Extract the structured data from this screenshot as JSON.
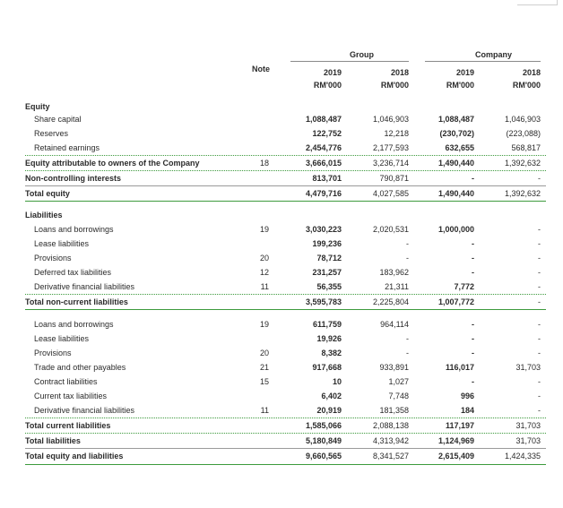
{
  "header": {
    "note": "Note",
    "group_label": "Group",
    "company_label": "Company",
    "years": [
      "2019",
      "2018",
      "2019",
      "2018"
    ],
    "units": [
      "RM'000",
      "RM'000",
      "RM'000",
      "RM'000"
    ]
  },
  "sections": {
    "equity": "Equity",
    "liabilities": "Liabilities"
  },
  "rows": [
    {
      "label": "Share capital",
      "note": "",
      "g19": "1,088,487",
      "g18": "1,046,903",
      "c19": "1,088,487",
      "c18": "1,046,903"
    },
    {
      "label": "Reserves",
      "note": "",
      "g19": "122,752",
      "g18": "12,218",
      "c19": "(230,702)",
      "c18": "(223,088)"
    },
    {
      "label": "Retained earnings",
      "note": "",
      "g19": "2,454,776",
      "g18": "2,177,593",
      "c19": "632,655",
      "c18": "568,817"
    },
    {
      "label": "Equity attributable to owners of the Company",
      "note": "18",
      "g19": "3,666,015",
      "g18": "3,236,714",
      "c19": "1,490,440",
      "c18": "1,392,632"
    },
    {
      "label": "Non-controlling interests",
      "note": "",
      "g19": "813,701",
      "g18": "790,871",
      "c19": "-",
      "c18": "-"
    },
    {
      "label": "Total equity",
      "note": "",
      "g19": "4,479,716",
      "g18": "4,027,585",
      "c19": "1,490,440",
      "c18": "1,392,632"
    },
    {
      "label": "Loans and borrowings",
      "note": "19",
      "g19": "3,030,223",
      "g18": "2,020,531",
      "c19": "1,000,000",
      "c18": "-"
    },
    {
      "label": "Lease liabilities",
      "note": "",
      "g19": "199,236",
      "g18": "-",
      "c19": "-",
      "c18": "-"
    },
    {
      "label": "Provisions",
      "note": "20",
      "g19": "78,712",
      "g18": "-",
      "c19": "-",
      "c18": "-"
    },
    {
      "label": "Deferred tax liabilities",
      "note": "12",
      "g19": "231,257",
      "g18": "183,962",
      "c19": "-",
      "c18": "-"
    },
    {
      "label": "Derivative financial liabilities",
      "note": "11",
      "g19": "56,355",
      "g18": "21,311",
      "c19": "7,772",
      "c18": "-"
    },
    {
      "label": "Total non-current liabilities",
      "note": "",
      "g19": "3,595,783",
      "g18": "2,225,804",
      "c19": "1,007,772",
      "c18": "-"
    },
    {
      "label": "Loans and borrowings",
      "note": "19",
      "g19": "611,759",
      "g18": "964,114",
      "c19": "-",
      "c18": "-"
    },
    {
      "label": "Lease liabilities",
      "note": "",
      "g19": "19,926",
      "g18": "-",
      "c19": "-",
      "c18": "-"
    },
    {
      "label": "Provisions",
      "note": "20",
      "g19": "8,382",
      "g18": "-",
      "c19": "-",
      "c18": "-"
    },
    {
      "label": "Trade and other payables",
      "note": "21",
      "g19": "917,668",
      "g18": "933,891",
      "c19": "116,017",
      "c18": "31,703"
    },
    {
      "label": "Contract liabilities",
      "note": "15",
      "g19": "10",
      "g18": "1,027",
      "c19": "-",
      "c18": "-"
    },
    {
      "label": "Current tax liabilities",
      "note": "",
      "g19": "6,402",
      "g18": "7,748",
      "c19": "996",
      "c18": "-"
    },
    {
      "label": "Derivative financial liabilities",
      "note": "11",
      "g19": "20,919",
      "g18": "181,358",
      "c19": "184",
      "c18": "-"
    },
    {
      "label": "Total current liabilities",
      "note": "",
      "g19": "1,585,066",
      "g18": "2,088,138",
      "c19": "117,197",
      "c18": "31,703"
    },
    {
      "label": "Total liabilities",
      "note": "",
      "g19": "5,180,849",
      "g18": "4,313,942",
      "c19": "1,124,969",
      "c18": "31,703"
    },
    {
      "label": "Total equity and liabilities",
      "note": "",
      "g19": "9,660,565",
      "g18": "8,341,527",
      "c19": "2,615,409",
      "c18": "1,424,335"
    }
  ]
}
